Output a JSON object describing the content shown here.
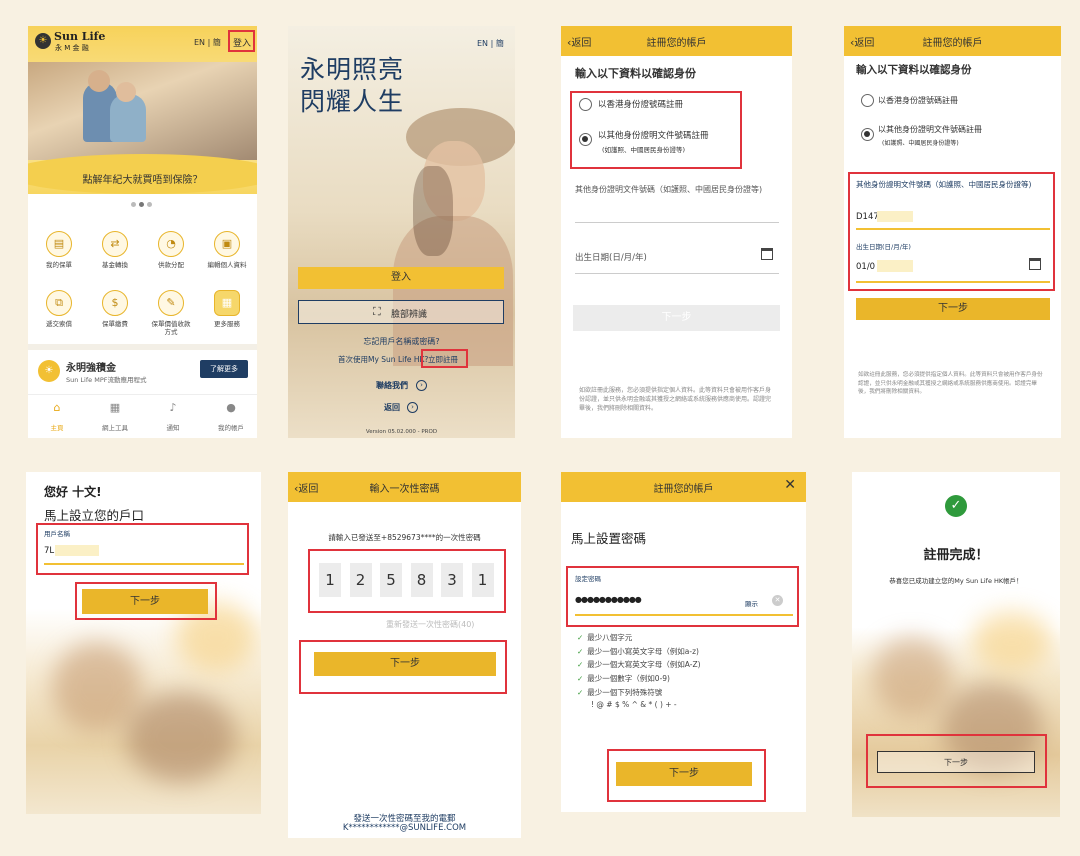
{
  "s1": {
    "brand": "Sun Life",
    "brand_cn": "永 M 金 融",
    "lang": "EN | 簡",
    "login": "登入",
    "banner_text": "點解年紀大就買唔到保險？",
    "icons": [
      {
        "label": "我的保單",
        "icon": "document-icon",
        "glyph": "▤"
      },
      {
        "label": "基金轉換",
        "icon": "swap-icon",
        "glyph": "⇄"
      },
      {
        "label": "供款分配",
        "icon": "pie-icon",
        "glyph": "◔"
      },
      {
        "label": "編輯個人資料",
        "icon": "profile-card-icon",
        "glyph": "▣"
      },
      {
        "label": "遞交索償",
        "icon": "claim-icon",
        "glyph": "⧉"
      },
      {
        "label": "保單繳費",
        "icon": "payment-icon",
        "glyph": "$"
      },
      {
        "label": "保單價值收款方式",
        "icon": "edit-icon",
        "glyph": "✎"
      },
      {
        "label": "更多服務",
        "icon": "grid-icon",
        "glyph": "▦"
      }
    ],
    "mpf_title": "永明強積金",
    "mpf_sub": "Sun Life MPF流動應用程式",
    "mpf_btn": "了解更多",
    "nav": [
      {
        "label": "主頁",
        "icon": "home-icon",
        "glyph": "⌂"
      },
      {
        "label": "網上工具",
        "icon": "calculator-icon",
        "glyph": "▦"
      },
      {
        "label": "通知",
        "icon": "bell-icon",
        "glyph": "♪"
      },
      {
        "label": "我的帳戶",
        "icon": "user-icon",
        "glyph": "●"
      }
    ]
  },
  "s2": {
    "lang": "EN | 簡",
    "slogan1": "永明照亮",
    "slogan2": "閃耀人生",
    "login_btn": "登入",
    "face_btn": "臉部辨識",
    "forgot": "忘記用戶名稱或密碼?",
    "first_time": "首次使用My Sun Life HK?",
    "register": "立即註冊",
    "contact": "聯絡我們",
    "back": "返回",
    "version": "Version 05.02.000 - PROD"
  },
  "s3": {
    "back": "返回",
    "title": "註冊您的帳戶",
    "heading": "輸入以下資料以確認身份",
    "opt1": "以香港身份證號碼註冊",
    "opt2": "以其他身份證明文件號碼註冊",
    "opt2_sub": "(如護照、中國居民身份證等)",
    "field1": "其他身份證明文件號碼（如護照、中國居民身份證等)",
    "field2": "出生日期(日/月/年)",
    "next": "下一步",
    "disclaimer": "如欲註冊此服務，您必須提供指定個人資料。此等資料只會被用作客戶身份認證，並只供永明金融或其獲授之網絡或系統服務供應商使用。認證完畢後，我們將刪除相關資料。"
  },
  "s4": {
    "back": "返回",
    "title": "註冊您的帳戶",
    "heading": "輸入以下資料以確認身份",
    "opt1": "以香港身份證號碼註冊",
    "opt2": "以其他身份證明文件號碼註冊",
    "opt2_sub": "(如護照、中國居民身份證等)",
    "field1": "其他身份證明文件號碼（如護照、中國居民身份證等)",
    "field1_value": "D147",
    "field2": "出生日期(日/月/年)",
    "field2_value": "01/0",
    "next": "下一步",
    "disclaimer": "如欲註冊此服務，您必須提供指定個人資料。此等資料只會被用作客戶身份認證，並只供永明金融或其獲授之網絡或系統服務供應商使用。認證完畢後，我們將刪除相關資料。"
  },
  "s5": {
    "greet": "您好 十文!",
    "heading": "馬上設立您的戶口",
    "field": "用戶名稱",
    "value": "7L",
    "next": "下一步"
  },
  "s6": {
    "back": "返回",
    "title": "輸入一次性密碼",
    "prompt": "請輸入已發送至+8529673****的一次性密碼",
    "digits": [
      "1",
      "2",
      "5",
      "8",
      "3",
      "1"
    ],
    "resend": "重新發送一次性密碼(40)",
    "next": "下一步",
    "email_line1": "發送一次性密碼至我的電郵",
    "email_line2": "K************@SUNLIFE.COM"
  },
  "s7": {
    "title": "註冊您的帳戶",
    "heading": "馬上設置密碼",
    "field": "設定密碼",
    "value": "●●●●●●●●●●●",
    "show": "顯示",
    "rules": [
      "最少八個字元",
      "最少一個小寫英文字母（例如a-z)",
      "最少一個大寫英文字母（例如A-Z)",
      "最少一個數字（例如0-9)",
      "最少一個下列特殊符號"
    ],
    "symbols": "! @ # $ % ^ & * ( ) + -",
    "next": "下一步"
  },
  "s8": {
    "done": "註冊完成！",
    "msg": "恭喜您已成功建立您的My Sun Life HK帳戶！",
    "next": "下一步"
  },
  "colors": {
    "yellow": "#f2c033",
    "red": "#e0333c",
    "bg": "#f8f1e2"
  }
}
